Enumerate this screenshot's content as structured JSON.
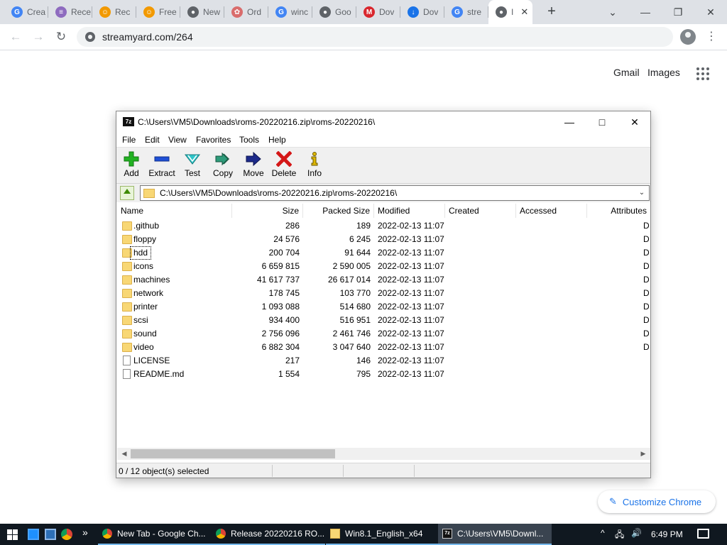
{
  "browser": {
    "tabs": [
      {
        "label": "Crea",
        "icon": "google-icon",
        "color": "#4285f4"
      },
      {
        "label": "Rece",
        "icon": "document-icon",
        "color": "#8e6bbf"
      },
      {
        "label": "Rec",
        "icon": "recipe-icon",
        "color": "#f29900"
      },
      {
        "label": "Free",
        "icon": "recipe-icon",
        "color": "#f29900"
      },
      {
        "label": "New",
        "icon": "chrome-icon",
        "color": "#5f6368"
      },
      {
        "label": "Ord",
        "icon": "flower-icon",
        "color": "#d96c6c"
      },
      {
        "label": "winc",
        "icon": "google-icon",
        "color": "#4285f4"
      },
      {
        "label": "Goo",
        "icon": "chrome-icon",
        "color": "#5f6368"
      },
      {
        "label": "Dov",
        "icon": "mega-icon",
        "color": "#d9272e"
      },
      {
        "label": "Dov",
        "icon": "download-icon",
        "color": "#1a73e8"
      },
      {
        "label": "stre",
        "icon": "google-icon",
        "color": "#4285f4"
      },
      {
        "label": "I",
        "icon": "chrome-icon",
        "color": "#5f6368"
      }
    ],
    "tab_close_glyph": "✕",
    "new_tab_glyph": "+",
    "url": "streamyard.com/264"
  },
  "ntp": {
    "gmail": "Gmail",
    "images": "Images",
    "customize": "Customize Chrome",
    "customize_glyph": "✎"
  },
  "zip": {
    "title": "C:\\Users\\VM5\\Downloads\\roms-20220216.zip\\roms-20220216\\",
    "app_icon_text": "7z",
    "menu": [
      "File",
      "Edit",
      "View",
      "Favorites",
      "Tools",
      "Help"
    ],
    "toolbar": [
      "Add",
      "Extract",
      "Test",
      "Copy",
      "Move",
      "Delete",
      "Info"
    ],
    "address": "C:\\Users\\VM5\\Downloads\\roms-20220216.zip\\roms-20220216\\",
    "columns": [
      "Name",
      "Size",
      "Packed Size",
      "Modified",
      "Created",
      "Accessed",
      "Attributes"
    ],
    "rows": [
      {
        "name": ".github",
        "size": "286",
        "packed": "189",
        "modified": "2022-02-13 11:07",
        "type": "folder",
        "attr": "D"
      },
      {
        "name": "floppy",
        "size": "24 576",
        "packed": "6 245",
        "modified": "2022-02-13 11:07",
        "type": "folder",
        "attr": "D"
      },
      {
        "name": "hdd",
        "size": "200 704",
        "packed": "91 644",
        "modified": "2022-02-13 11:07",
        "type": "folder",
        "attr": "D"
      },
      {
        "name": "icons",
        "size": "6 659 815",
        "packed": "2 590 005",
        "modified": "2022-02-13 11:07",
        "type": "folder",
        "attr": "D"
      },
      {
        "name": "machines",
        "size": "41 617 737",
        "packed": "26 617 014",
        "modified": "2022-02-13 11:07",
        "type": "folder",
        "attr": "D"
      },
      {
        "name": "network",
        "size": "178 745",
        "packed": "103 770",
        "modified": "2022-02-13 11:07",
        "type": "folder",
        "attr": "D"
      },
      {
        "name": "printer",
        "size": "1 093 088",
        "packed": "514 680",
        "modified": "2022-02-13 11:07",
        "type": "folder",
        "attr": "D"
      },
      {
        "name": "scsi",
        "size": "934 400",
        "packed": "516 951",
        "modified": "2022-02-13 11:07",
        "type": "folder",
        "attr": "D"
      },
      {
        "name": "sound",
        "size": "2 756 096",
        "packed": "2 461 746",
        "modified": "2022-02-13 11:07",
        "type": "folder",
        "attr": "D"
      },
      {
        "name": "video",
        "size": "6 882 304",
        "packed": "3 047 640",
        "modified": "2022-02-13 11:07",
        "type": "folder",
        "attr": "D"
      },
      {
        "name": "LICENSE",
        "size": "217",
        "packed": "146",
        "modified": "2022-02-13 11:07",
        "type": "file",
        "attr": ""
      },
      {
        "name": "README.md",
        "size": "1 554",
        "packed": "795",
        "modified": "2022-02-13 11:07",
        "type": "file",
        "attr": ""
      }
    ],
    "status": "0 / 12 object(s) selected"
  },
  "taskbar": {
    "overflow_glyph": "»",
    "tasks": [
      {
        "label": "New Tab - Google Ch...",
        "icon": "chrome-icon"
      },
      {
        "label": "Release 20220216 RO...",
        "icon": "chrome-icon"
      },
      {
        "label": "Win8.1_English_x64",
        "icon": "folder-icon"
      },
      {
        "label": "C:\\Users\\VM5\\Downl...",
        "icon": "7zip-icon"
      }
    ],
    "tray_glyphs": {
      "chevron": "^",
      "network": "🖧",
      "volume": "🔊"
    },
    "clock": "6:49 PM"
  },
  "colors": {
    "accent": "#1a73e8",
    "folder": "#f8d775",
    "taskbar": "#101820"
  }
}
